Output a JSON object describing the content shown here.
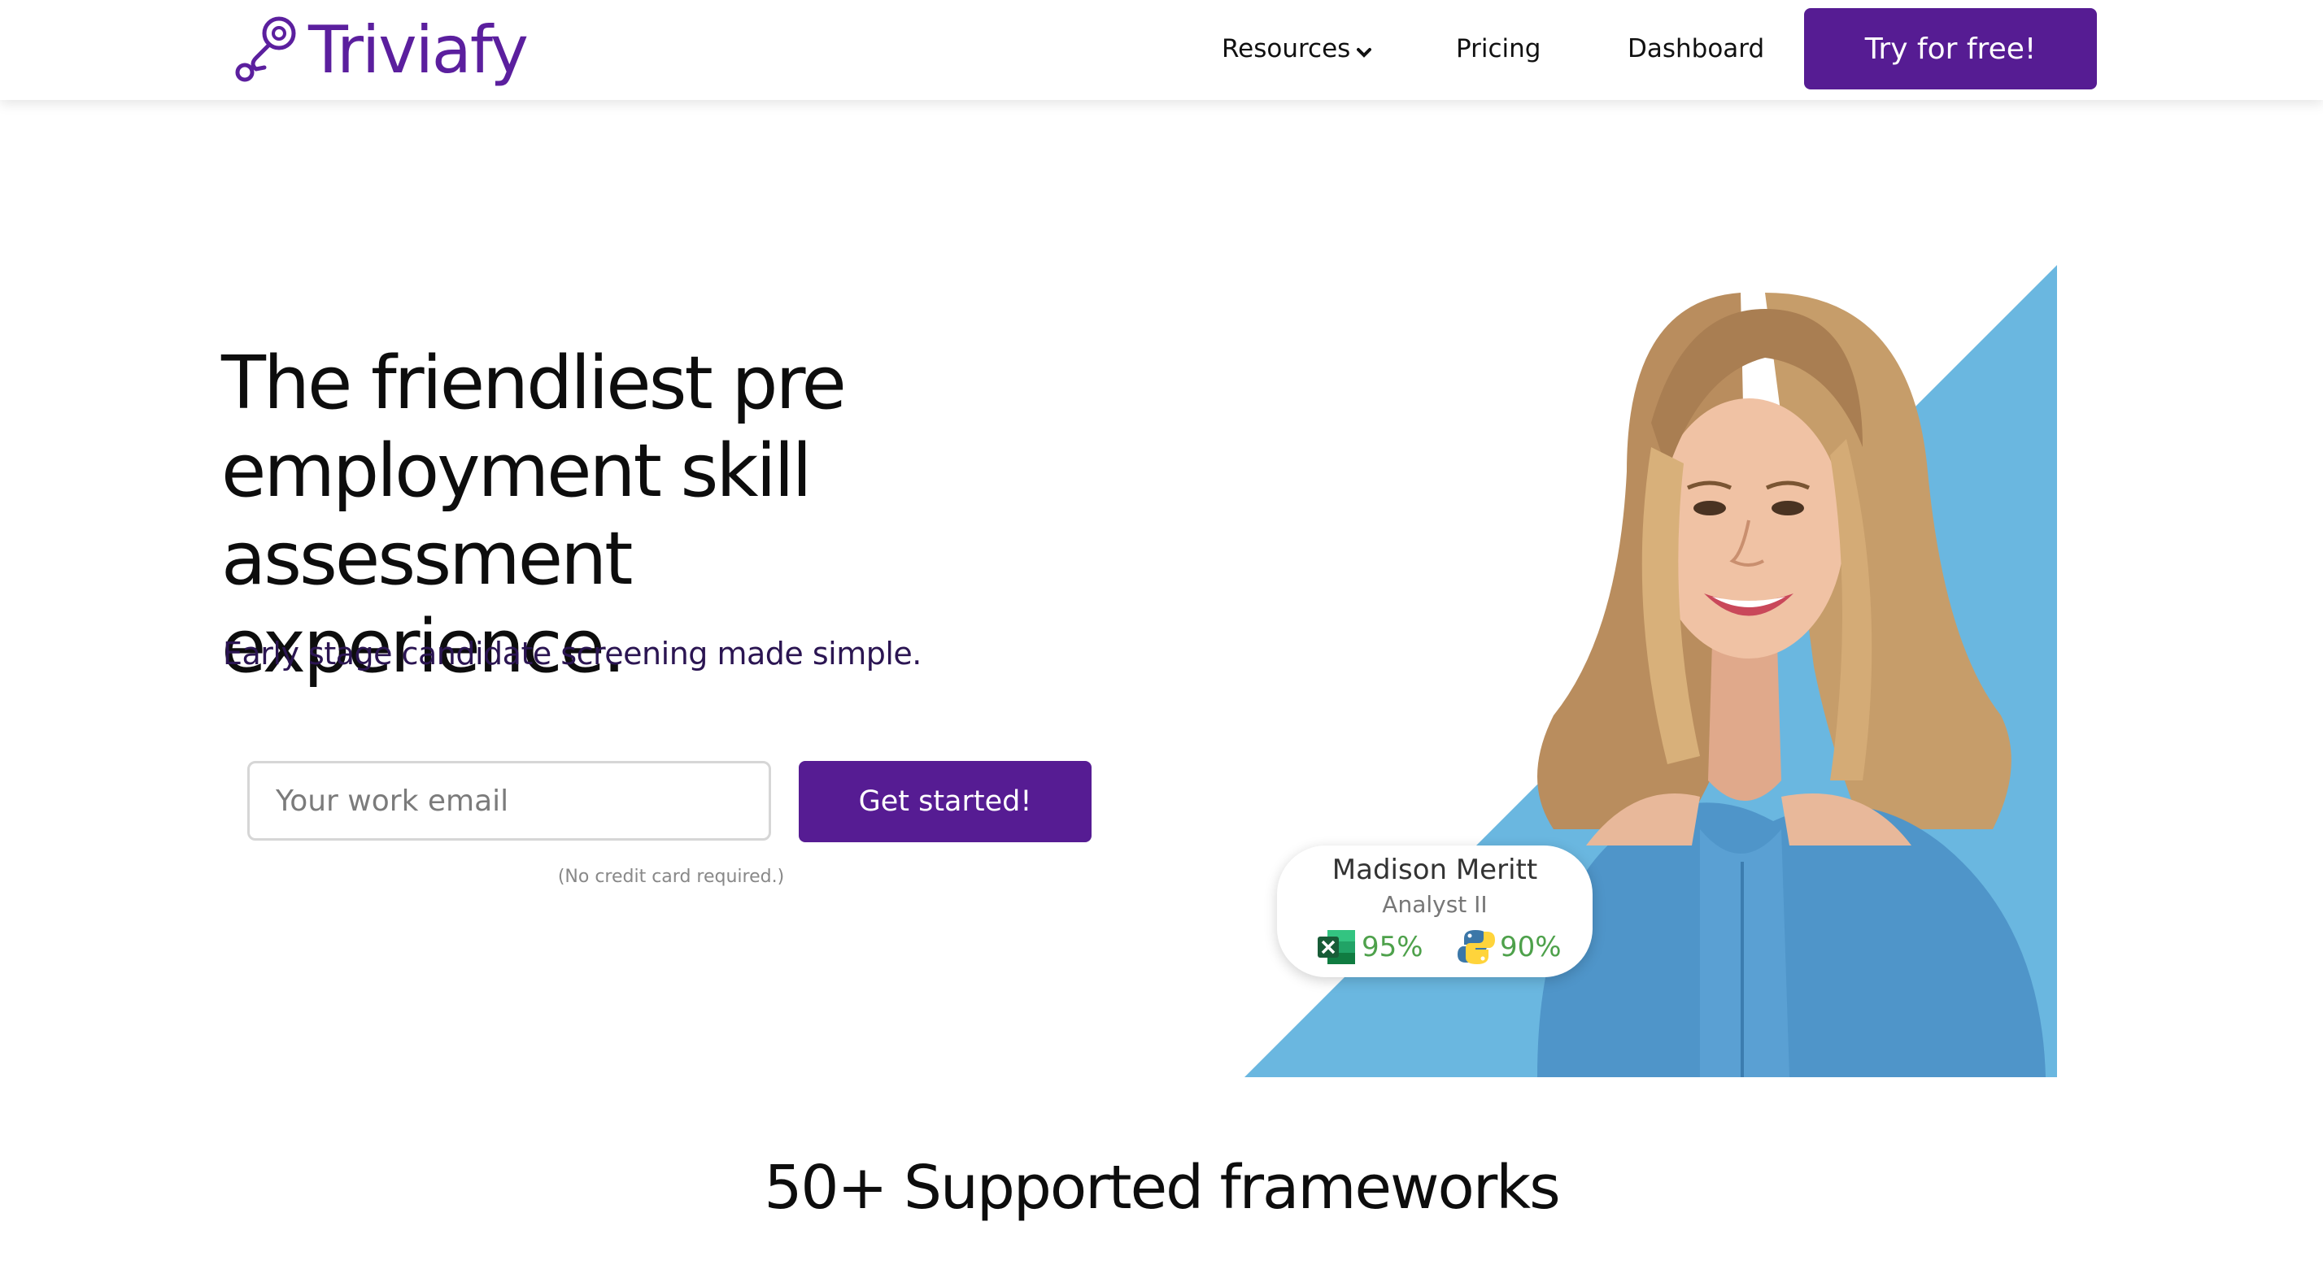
{
  "brand": {
    "name": "Triviafy",
    "logo_icon": "key-link-icon",
    "color": "#5b1f9e"
  },
  "nav": {
    "items": [
      {
        "label": "Resources",
        "icon": "chevron-down-icon"
      },
      {
        "label": "Pricing"
      },
      {
        "label": "Dashboard"
      }
    ],
    "cta_label": "Try for free!"
  },
  "hero": {
    "title_lines": [
      "The friendliest pre",
      "employment skill",
      "assessment experience."
    ],
    "subtitle": "Early stage candidate screening made simple.",
    "email_placeholder": "Your work email",
    "cta_label": "Get started!",
    "note": "(No credit card required.)"
  },
  "profile_card": {
    "name": "Madison Meritt",
    "role": "Analyst II",
    "scores": [
      {
        "icon": "excel-icon",
        "value": "95%"
      },
      {
        "icon": "python-icon",
        "value": "90%"
      }
    ]
  },
  "frameworks": {
    "heading": "50+ Supported frameworks"
  },
  "colors": {
    "primary": "#561c93",
    "accent_blue": "#6ab7e0",
    "score_green": "#4ea14b"
  }
}
